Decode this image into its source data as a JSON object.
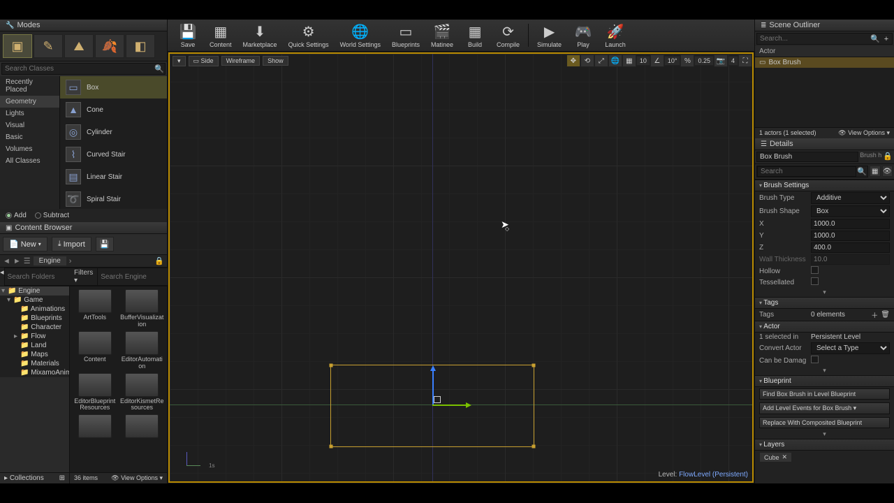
{
  "modes": {
    "title": "Modes",
    "search_ph": "Search Classes",
    "categories": [
      "Recently Placed",
      "Geometry",
      "Lights",
      "Visual",
      "Basic",
      "Volumes",
      "All Classes"
    ],
    "selected_category": "Geometry",
    "shapes": [
      "Box",
      "Cone",
      "Cylinder",
      "Curved Stair",
      "Linear Stair",
      "Spiral Stair"
    ],
    "selected_shape": "Box",
    "add": "Add",
    "subtract": "Subtract"
  },
  "content_browser": {
    "title": "Content Browser",
    "new": "New",
    "import": "Import",
    "crumb": "Engine",
    "search_folders_ph": "Search Folders",
    "filters": "Filters",
    "search_engine_ph": "Search Engine",
    "tree": {
      "root": "Engine",
      "children": [
        "Game",
        "Animations",
        "Blueprints",
        "Character",
        "Flow",
        "Land",
        "Maps",
        "Materials",
        "MixamoAnimPac"
      ]
    },
    "assets": [
      "ArtTools",
      "BufferVisualization",
      "Content",
      "EditorAutomation",
      "EditorBlueprintResources",
      "EditorKismetResources"
    ],
    "collections": "Collections",
    "footer_count": "36 items",
    "view_options": "View Options"
  },
  "toolbar": {
    "items": [
      "Save",
      "Content",
      "Marketplace",
      "Quick Settings",
      "World Settings",
      "Blueprints",
      "Matinee",
      "Build",
      "Compile",
      "Simulate",
      "Play",
      "Launch"
    ],
    "icons": [
      "💾",
      "▦",
      "⬇",
      "⚙",
      "🌐",
      "▭",
      "🎬",
      "▦",
      "⟳",
      "▶",
      "🎮",
      "🚀"
    ]
  },
  "viewport": {
    "mode": "Side",
    "wire": "Wireframe",
    "show": "Show",
    "snap_pos": "10",
    "snap_rot": "10°",
    "snap_scale": "0.25",
    "cam_speed": "4",
    "axis_scale": "1s",
    "level_label": "Level:",
    "level_name": "FlowLevel (Persistent)"
  },
  "outliner": {
    "title": "Scene Outliner",
    "search_ph": "Search...",
    "col": "Actor",
    "item": "Box Brush",
    "footer": "1 actors (1 selected)",
    "view_options": "View Options"
  },
  "details": {
    "title": "Details",
    "name": "Box Brush",
    "brush_h": "Brush h",
    "search_ph": "Search",
    "brush_settings": {
      "hdr": "Brush Settings",
      "brush_type": "Brush Type",
      "brush_type_v": "Additive",
      "brush_shape": "Brush Shape",
      "brush_shape_v": "Box",
      "x": "X",
      "xv": "1000.0",
      "y": "Y",
      "yv": "1000.0",
      "z": "Z",
      "zv": "400.0",
      "wall": "Wall Thickness",
      "wallv": "10.0",
      "hollow": "Hollow",
      "tess": "Tessellated"
    },
    "tags": {
      "hdr": "Tags",
      "lbl": "Tags",
      "val": "0 elements"
    },
    "actor": {
      "hdr": "Actor",
      "sel": "1 selected in",
      "selv": "Persistent Level",
      "conv": "Convert Actor",
      "convv": "Select a Type",
      "dmg": "Can be Damag"
    },
    "blueprint": {
      "hdr": "Blueprint",
      "find": "Find Box Brush in Level Blueprint",
      "add": "Add Level Events for Box Brush",
      "replace": "Replace With Composited Blueprint"
    },
    "layers": {
      "hdr": "Layers",
      "item": "Cube"
    }
  }
}
